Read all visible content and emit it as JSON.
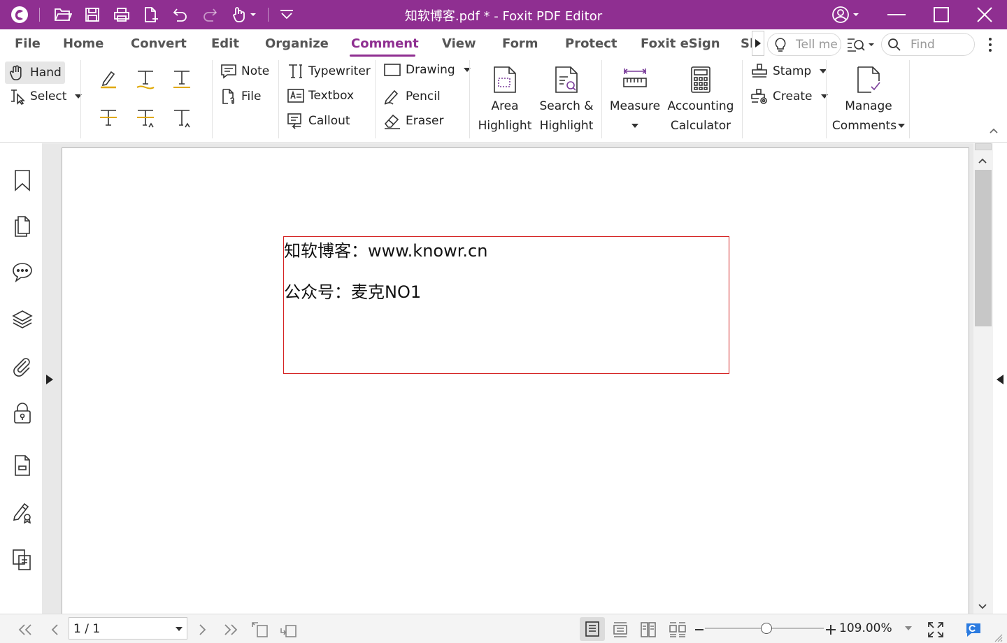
{
  "titlebar": {
    "title": "知软博客.pdf * - Foxit PDF Editor",
    "bg_color": "#8f2f91"
  },
  "menu": {
    "tabs": [
      "File",
      "Home",
      "Convert",
      "Edit",
      "Organize",
      "Comment",
      "View",
      "Form",
      "Protect",
      "Foxit eSign",
      "Sh"
    ],
    "active_tab": "Comment",
    "tell_me_placeholder": "Tell me",
    "find_placeholder": "Find"
  },
  "ribbon": {
    "hand": "Hand",
    "select": "Select",
    "note": "Note",
    "file": "File",
    "typewriter": "Typewriter",
    "textbox": "Textbox",
    "callout": "Callout",
    "drawing": "Drawing",
    "pencil": "Pencil",
    "eraser": "Eraser",
    "area_highlight_1": "Area",
    "area_highlight_2": "Highlight",
    "search_highlight_1": "Search &",
    "search_highlight_2": "Highlight",
    "measure": "Measure",
    "accounting_1": "Accounting",
    "accounting_2": "Calculator",
    "stamp": "Stamp",
    "create": "Create",
    "manage_1": "Manage",
    "manage_2": "Comments"
  },
  "document": {
    "line1": "知软博客：www.knowr.cn",
    "line2": "公众号：麦克NO1",
    "box_color": "#d42020"
  },
  "status": {
    "page": "1 / 1",
    "zoom": "109.00%",
    "zoom_slider_fraction": 0.5
  },
  "icons": {
    "left_nav": [
      "bookmark-icon",
      "pages-icon",
      "comments-icon",
      "layers-icon",
      "attachment-icon",
      "security-icon",
      "page-panel-icon",
      "signature-icon",
      "compare-icon"
    ]
  }
}
